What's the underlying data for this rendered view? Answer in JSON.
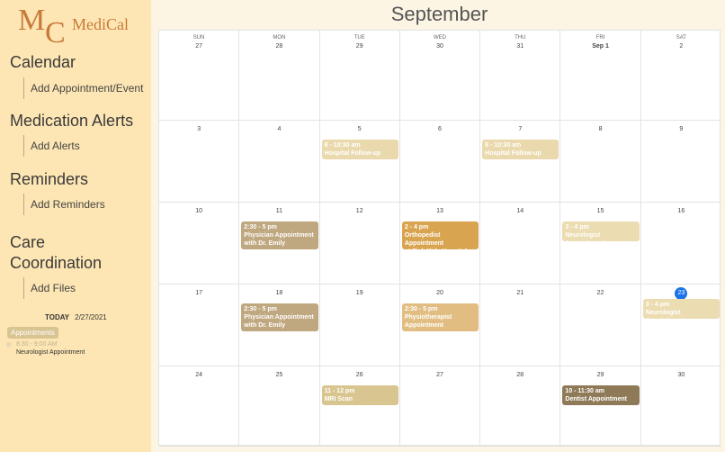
{
  "sidebar": {
    "logo_m": "M",
    "logo_c": "C",
    "logo_text": "MediCal",
    "sections": [
      {
        "title": "Calendar",
        "link": "Add Appointment/Event"
      },
      {
        "title": "Medication Alerts",
        "link": "Add Alerts"
      },
      {
        "title": "Reminders",
        "link": "Add Reminders"
      },
      {
        "title_line1": "Care",
        "title_line2": "Coordination",
        "link": "Add Files"
      }
    ],
    "today": {
      "label": "TODAY",
      "date": "2/27/2021",
      "badge": "Appointments",
      "time": "8:30 - 9:00 AM",
      "title": "Neurologist Appointment"
    }
  },
  "calendar": {
    "month": "September",
    "weekdays": [
      "SUN",
      "MON",
      "TUE",
      "WED",
      "THU",
      "FRI",
      "SAT"
    ],
    "weeks": [
      [
        "27",
        "28",
        "29",
        "30",
        "31",
        "Sep 1",
        "2"
      ],
      [
        "3",
        "4",
        "5",
        "6",
        "7",
        "8",
        "9"
      ],
      [
        "10",
        "11",
        "12",
        "13",
        "14",
        "15",
        "16"
      ],
      [
        "17",
        "18",
        "19",
        "20",
        "21",
        "22",
        "23"
      ],
      [
        "24",
        "25",
        "26",
        "27",
        "28",
        "29",
        "30"
      ]
    ],
    "events": [
      {
        "week": 1,
        "day": 2,
        "time": "8 - 10:30 am",
        "title": "Hospital Follow-up",
        "color": "#ead9ad"
      },
      {
        "week": 1,
        "day": 4,
        "time": "8 - 10:30 am",
        "title": "Hospital Follow-up",
        "color": "#ead9ad"
      },
      {
        "week": 2,
        "day": 1,
        "time": "2:30 - 5 pm",
        "title": "Physician Appointment",
        "title2": "with Dr. Emily",
        "color": "#bfa77f"
      },
      {
        "week": 2,
        "day": 3,
        "time": "2 - 4 pm",
        "title": "Orthopedist Appointment",
        "title2": "at Sick Kids Hospital",
        "color": "#d9a450"
      },
      {
        "week": 2,
        "day": 5,
        "time": "3 - 4 pm",
        "title": "Neurologist Appointment",
        "color": "#ecdcb1"
      },
      {
        "week": 3,
        "day": 1,
        "time": "2:30 - 5 pm",
        "title": "Physician Appointment",
        "title2": "with Dr. Emily",
        "color": "#bfa77f"
      },
      {
        "week": 3,
        "day": 3,
        "time": "2:30 - 5 pm",
        "title": "Physiotherapist",
        "title2": "Appointment",
        "color": "#e2bd82"
      },
      {
        "week": 3,
        "day": 6,
        "time": "3 - 4 pm",
        "title": "Neurologist Appointment",
        "color": "#ecdcb1"
      },
      {
        "week": 4,
        "day": 2,
        "time": "11 - 12 pm",
        "title": "MRI Scan",
        "color": "#d8c58f"
      },
      {
        "week": 4,
        "day": 5,
        "time": "10 - 11:30 am",
        "title": "Dentist Appointment",
        "color": "#8f7a58"
      }
    ]
  }
}
